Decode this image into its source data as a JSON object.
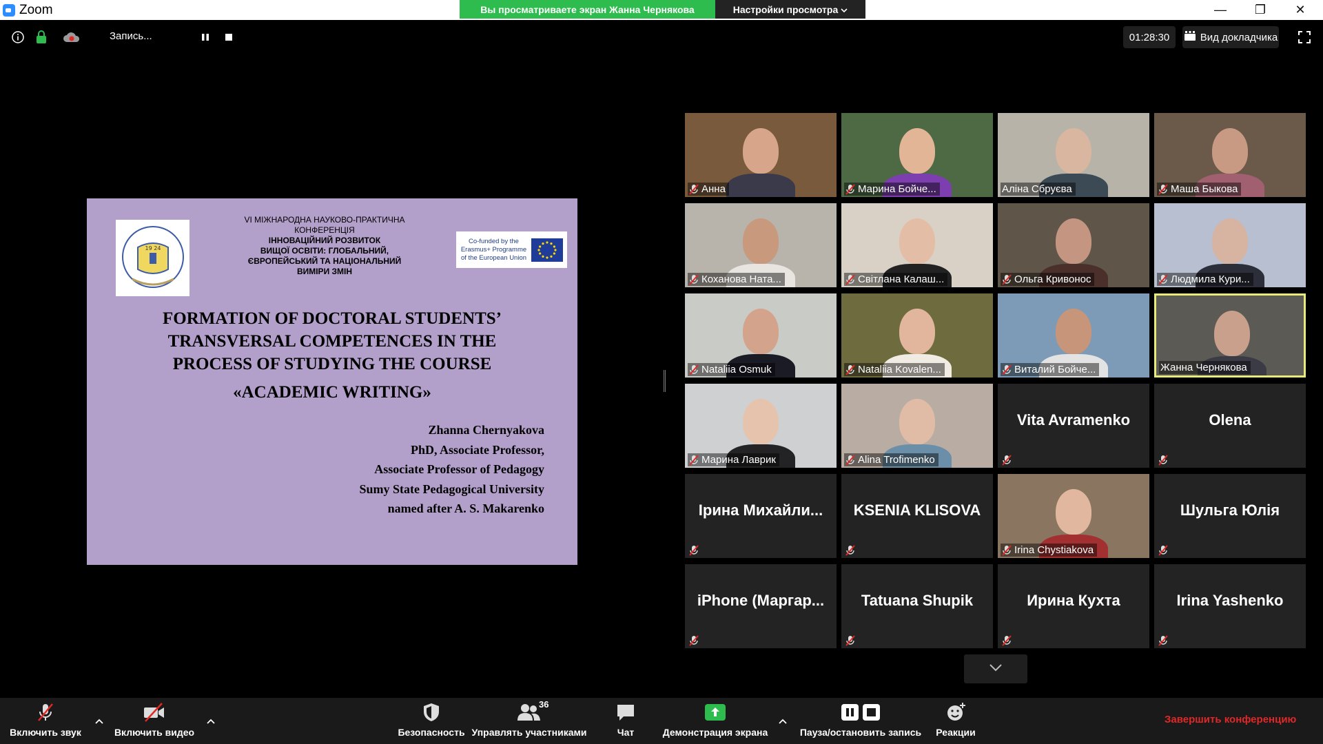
{
  "window": {
    "app_name": "Zoom",
    "share_banner": "Вы просматриваете экран Жанна Чернякова",
    "view_options": "Настройки просмотра",
    "min_glyph": "—",
    "restore_glyph": "❐",
    "close_glyph": "✕"
  },
  "top_toolbar": {
    "recording_label": "Запись...",
    "timer": "01:28:30",
    "speaker_view": "Вид докладчика"
  },
  "slide": {
    "conference_line1": "VI МІЖНАРОДНА  НАУКОВО-ПРАКТИЧНА",
    "conference_line2": "КОНФЕРЕНЦІЯ",
    "conference_title1": "ІННОВАЦІЙНИЙ РОЗВИТОК",
    "conference_title2": "ВИЩОЇ ОСВІТИ: ГЛОБАЛЬНИЙ,",
    "conference_title3": "ЄВРОПЕЙСЬКИЙ ТА НАЦІОНАЛЬНИЙ",
    "conference_title4": "ВИМІРИ ЗМІН",
    "logo_year": "19 24",
    "eu_line1": "Co-funded by the",
    "eu_line2": "Erasmus+ Programme",
    "eu_line3": "of the European Union",
    "title_line1": "FORMATION OF DOCTORAL STUDENTS’",
    "title_line2": "TRANSVERSAL COMPETENCES IN THE",
    "title_line3": "PROCESS OF STUDYING THE COURSE",
    "subtitle": "«ACADEMIC WRITING»",
    "author_name": "Zhanna  Chernyakova",
    "author_degree": "PhD, Associate Professor,",
    "author_position": "Associate Professor of Pedagogy",
    "author_university1": "Sumy State Pedagogical University",
    "author_university2": "named after A. S. Makarenko"
  },
  "participants": [
    {
      "name": "Анна",
      "video": true,
      "muted": true,
      "bg": "#7a5a3c",
      "skin": "#d6a58a",
      "cloth": "#3a3a4a"
    },
    {
      "name": "Марина Бойче...",
      "video": true,
      "muted": true,
      "bg": "#4d6a45",
      "skin": "#e2b596",
      "cloth": "#7d3fb0"
    },
    {
      "name": "Аліна Сбруєва",
      "video": true,
      "muted": false,
      "bg": "#b7b3a8",
      "skin": "#d8b6a0",
      "cloth": "#3c4a55"
    },
    {
      "name": "Маша Быкова",
      "video": true,
      "muted": true,
      "bg": "#6b5a49",
      "skin": "#c99a83",
      "cloth": "#a06070"
    },
    {
      "name": "Коханова Ната...",
      "video": true,
      "muted": true,
      "bg": "#b8b3ab",
      "skin": "#c8997d",
      "cloth": "#e8e4e0"
    },
    {
      "name": "Світлана Калаш...",
      "video": true,
      "muted": true,
      "bg": "#d9d1c6",
      "skin": "#e3bda5",
      "cloth": "#222222"
    },
    {
      "name": "Ольга Кривонос",
      "video": true,
      "muted": true,
      "bg": "#5f5548",
      "skin": "#c49682",
      "cloth": "#4a2f2a"
    },
    {
      "name": "Людмила Кури...",
      "video": true,
      "muted": true,
      "bg": "#b7bfd0",
      "skin": "#d7b3a1",
      "cloth": "#2c2f3a"
    },
    {
      "name": "Nataliia Osmuk",
      "video": true,
      "muted": true,
      "bg": "#c9cbc6",
      "skin": "#d3a38c",
      "cloth": "#1b1b25"
    },
    {
      "name": "Nataliia Kovalen...",
      "video": true,
      "muted": true,
      "bg": "#6e6b3e",
      "skin": "#e1b69d",
      "cloth": "#f0ece4"
    },
    {
      "name": "Виталий Бойче...",
      "video": true,
      "muted": true,
      "bg": "#7d9bb6",
      "skin": "#c7957a",
      "cloth": "#e3e3e3"
    },
    {
      "name": "Жанна Чернякова",
      "video": true,
      "muted": false,
      "active": true,
      "bg": "#5c5a55",
      "skin": "#c9a08c",
      "cloth": "#3b3b45"
    },
    {
      "name": "Марина Лаврик",
      "video": true,
      "muted": true,
      "bg": "#ced0d2",
      "skin": "#e6c3ad",
      "cloth": "#232326"
    },
    {
      "name": "Alina Trofimenko",
      "video": true,
      "muted": true,
      "bg": "#b9aca3",
      "skin": "#e0bca6",
      "cloth": "#6b8fa8"
    },
    {
      "name": "Vita Avramenko",
      "video": false,
      "muted": true
    },
    {
      "name": "Olena",
      "video": false,
      "muted": true
    },
    {
      "name": "Ірина  Михайли...",
      "video": false,
      "muted": true
    },
    {
      "name": "KSENIA KLISOVA",
      "video": false,
      "muted": true
    },
    {
      "name": "Irina Chystiakova",
      "video": true,
      "muted": true,
      "bg": "#8a7560",
      "skin": "#e2b79f",
      "cloth": "#a33030"
    },
    {
      "name": "Шульга Юлія",
      "video": false,
      "muted": true
    },
    {
      "name": "iPhone  (Маргар...",
      "video": false,
      "muted": true
    },
    {
      "name": "Tatuana Shupik",
      "video": false,
      "muted": true
    },
    {
      "name": "Ирина Кухта",
      "video": false,
      "muted": true
    },
    {
      "name": "Irina Yashenko",
      "video": false,
      "muted": true
    }
  ],
  "bottom_toolbar": {
    "unmute": "Включить звук",
    "start_video": "Включить видео",
    "security": "Безопасность",
    "participants": "Управлять участниками",
    "participants_count": "36",
    "chat": "Чат",
    "share": "Демонстрация экрана",
    "pause_record": "Пауза/остановить запись",
    "reactions": "Реакции",
    "end": "Завершить конференцию"
  },
  "colors": {
    "share_green": "#2ebc4f",
    "end_red": "#e02828",
    "active_speaker": "#e8eb7a",
    "slide_bg": "#b29fca"
  }
}
